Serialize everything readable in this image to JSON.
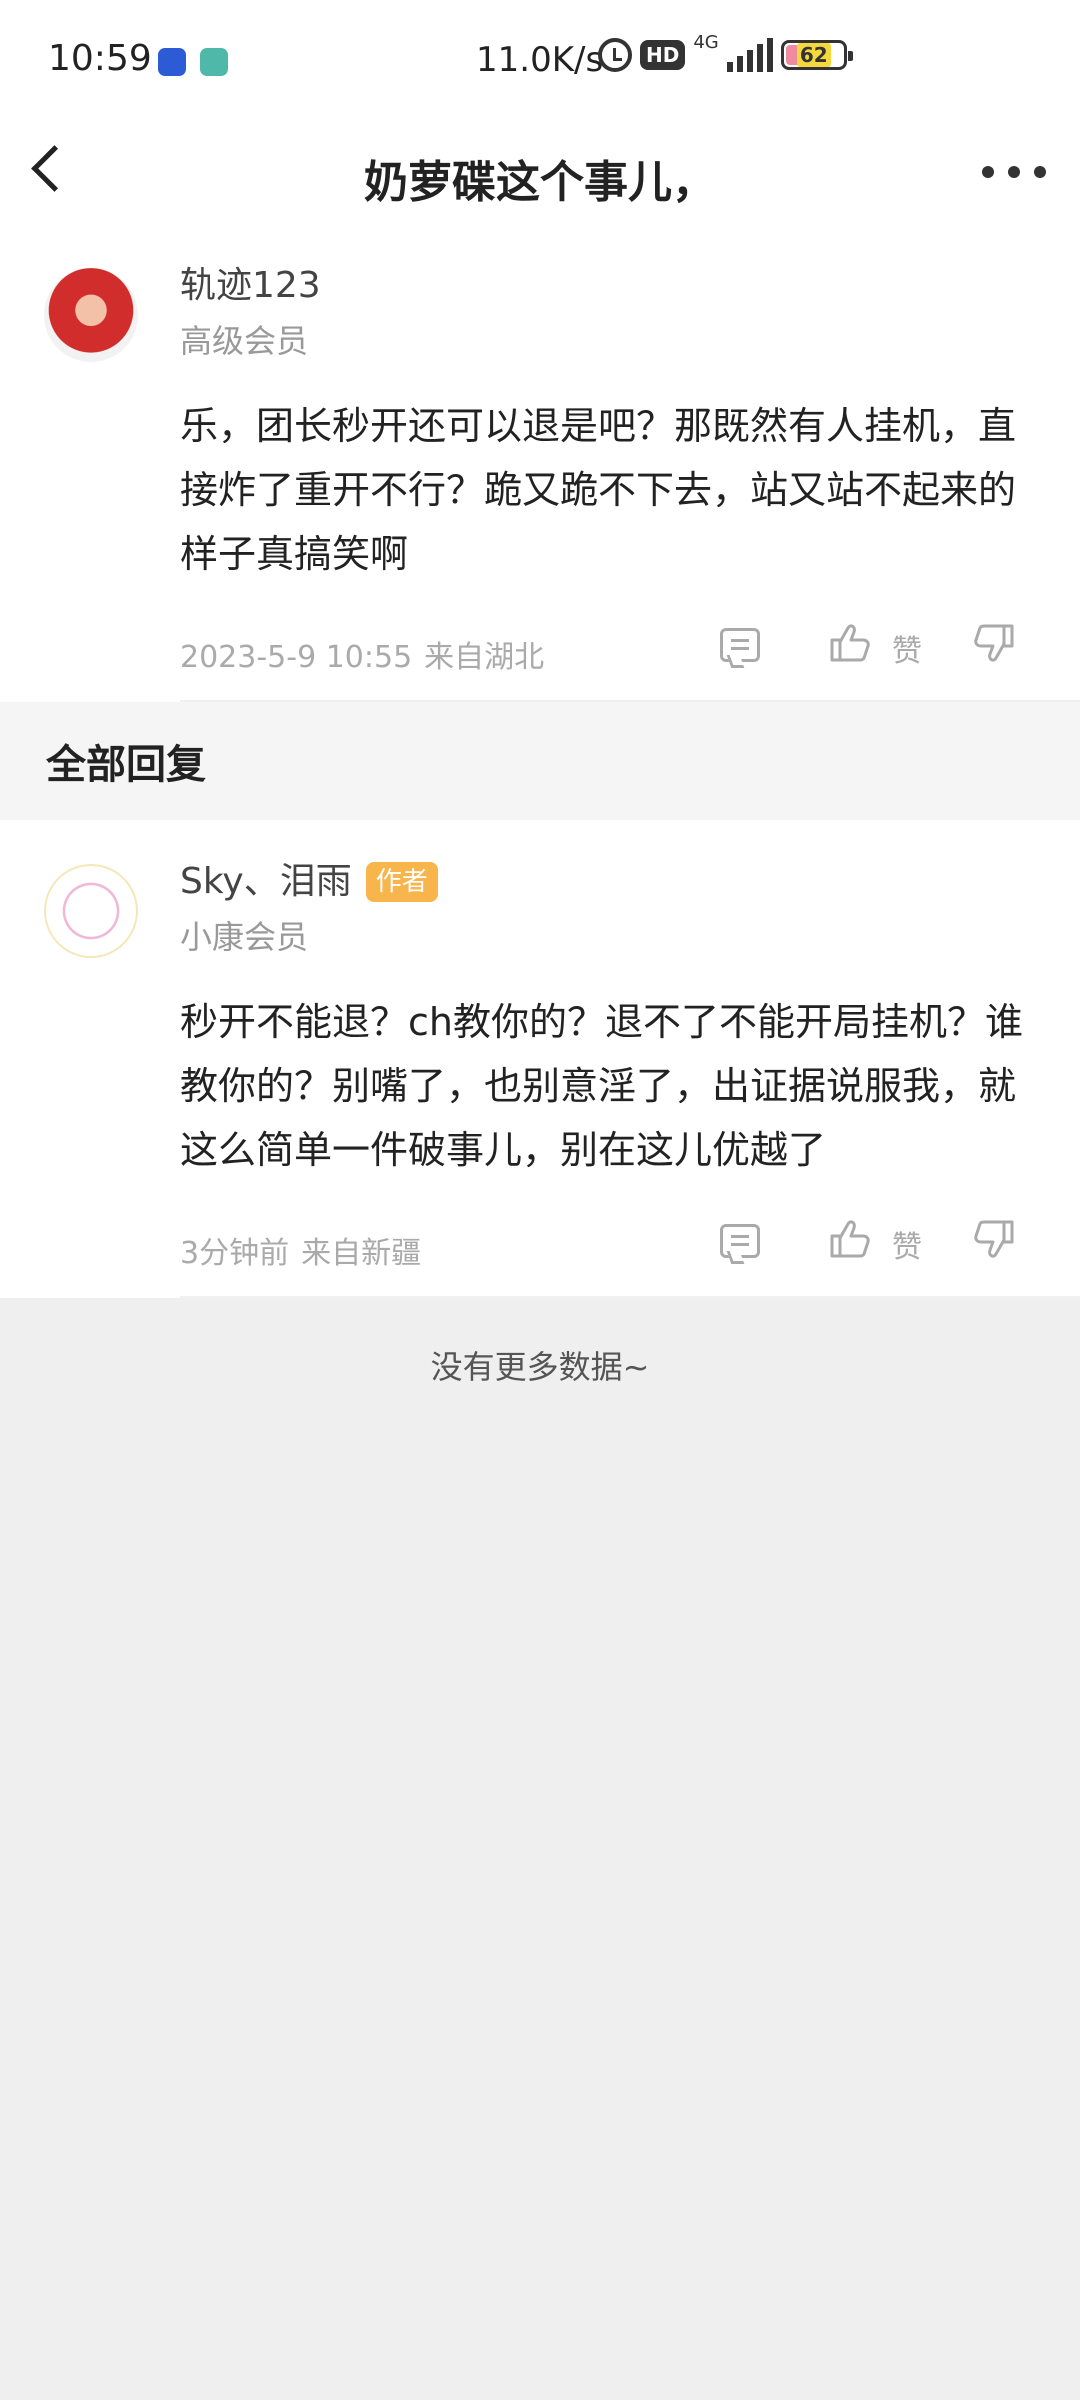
{
  "status_bar": {
    "time": "10:59",
    "network_speed": "11.0K/s",
    "hd_label": "HD",
    "network_type": "4G",
    "battery_level": "62",
    "battery_percent": 62
  },
  "header": {
    "title": "奶萝碟这个事儿，"
  },
  "post": {
    "username": "轨迹123",
    "level": "高级会员",
    "content": "乐，团长秒开还可以退是吧？那既然有人挂机，直接炸了重开不行？跪又跪不下去，站又站不起来的样子真搞笑啊",
    "time": "2023-5-9 10:55",
    "location": "来自湖北",
    "like_label": "赞"
  },
  "section": {
    "title": "全部回复"
  },
  "replies": [
    {
      "username": "Sky、泪雨",
      "badge": "作者",
      "level": "小康会员",
      "content": "秒开不能退？ch教你的？退不了不能开局挂机？谁教你的？别嘴了，也别意淫了，出证据说服我，就这么简单一件破事儿，别在这儿优越了",
      "time": "3分钟前",
      "location": "来自新疆",
      "like_label": "赞"
    }
  ],
  "footer": {
    "no_more": "没有更多数据~"
  },
  "colors": {
    "badge": "#f7b54b",
    "meta_gray": "#aaaaaa",
    "section_bg": "#f5f5f5",
    "page_bg": "#efefef"
  }
}
